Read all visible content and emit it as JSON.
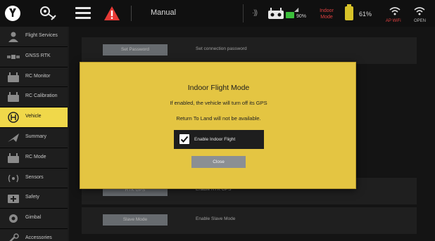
{
  "topbar": {
    "flight_mode": "Manual",
    "rc_battery": "90%",
    "indoor_mode": "Indoor Mode",
    "battery": "61%",
    "ap_wifi": "AP WiFi",
    "open": "OPEN",
    "icons": [
      "logo-icon",
      "vehicle-icon",
      "menu-icon",
      "warning-icon",
      "signal-icon",
      "rc-icon",
      "battery-icon",
      "wifi-icon"
    ]
  },
  "sidebar": {
    "items": [
      {
        "label": "Flight Services",
        "icon": "person-icon"
      },
      {
        "label": "GNSS RTK",
        "icon": "satellite-icon"
      },
      {
        "label": "RC Monitor",
        "icon": "rc-icon"
      },
      {
        "label": "RC Calibration",
        "icon": "rc-icon"
      },
      {
        "label": "Vehicle",
        "icon": "drone-icon",
        "active": true
      },
      {
        "label": "Summary",
        "icon": "plane-icon"
      },
      {
        "label": "RC Mode",
        "icon": "rc-icon"
      },
      {
        "label": "Sensors",
        "icon": "signal-icon"
      },
      {
        "label": "Safety",
        "icon": "plus-icon"
      },
      {
        "label": "Gimbal",
        "icon": "gear-icon"
      },
      {
        "label": "Accessories",
        "icon": "wrench-icon"
      }
    ]
  },
  "content": {
    "rows": [
      {
        "button": "Set Password",
        "desc": "Set connection password"
      },
      {
        "button": "RTK GPS",
        "desc": "Enable RTK GPS"
      },
      {
        "button": "Slave Mode",
        "desc": "Enable Slave Mode"
      }
    ]
  },
  "dialog": {
    "title": "Indoor Flight Mode",
    "line1": "If enabled, the vehicle will turn off its GPS",
    "line2": "Return To Land will not be available.",
    "checkbox_label": "Enable Indoor Flight",
    "checked": true,
    "close_label": "Close"
  },
  "colors": {
    "dialog_bg": "#e4c542",
    "active_sidebar": "#f0d84a",
    "warning": "#e53935",
    "alert_text": "#e04040"
  }
}
